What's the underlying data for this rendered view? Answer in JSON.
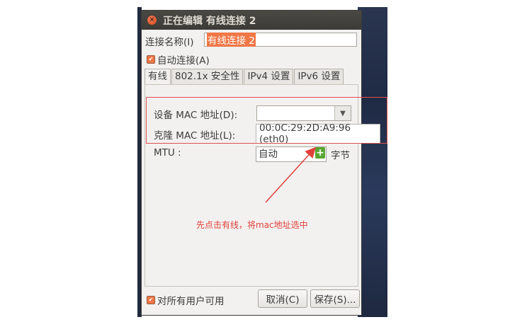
{
  "window": {
    "title": "正在编辑 有线连接 2",
    "close_icon": "×"
  },
  "form": {
    "connection_name_label": "连接名称(I)",
    "connection_name_value": "有线连接 2",
    "auto_connect_label": "自动连接(A)",
    "auto_connect_checked": true
  },
  "tabs": [
    {
      "label": "有线",
      "active": true
    },
    {
      "label": "802.1x 安全性",
      "active": false
    },
    {
      "label": "IPv4 设置",
      "active": false
    },
    {
      "label": "IPv6 设置",
      "active": false
    }
  ],
  "wired": {
    "device_mac_label": "设备 MAC 地址(D):",
    "device_mac_value": "",
    "device_mac_option": "00:0C:29:2D:A9:96 (eth0)",
    "cloned_mac_label": "克隆 MAC 地址(L):",
    "mtu_label": "MTU :",
    "mtu_value": "自动",
    "mtu_unit": "字节"
  },
  "footer": {
    "all_users_label": "对所有用户可用",
    "all_users_checked": true,
    "cancel_label": "取消(C)",
    "save_label": "保存(S)..."
  },
  "annotation": {
    "text": "先点击有线，将mac地址选中",
    "color": "#e0413a"
  },
  "colors": {
    "accent": "#f07746",
    "titlebar": "#3c3b37"
  }
}
